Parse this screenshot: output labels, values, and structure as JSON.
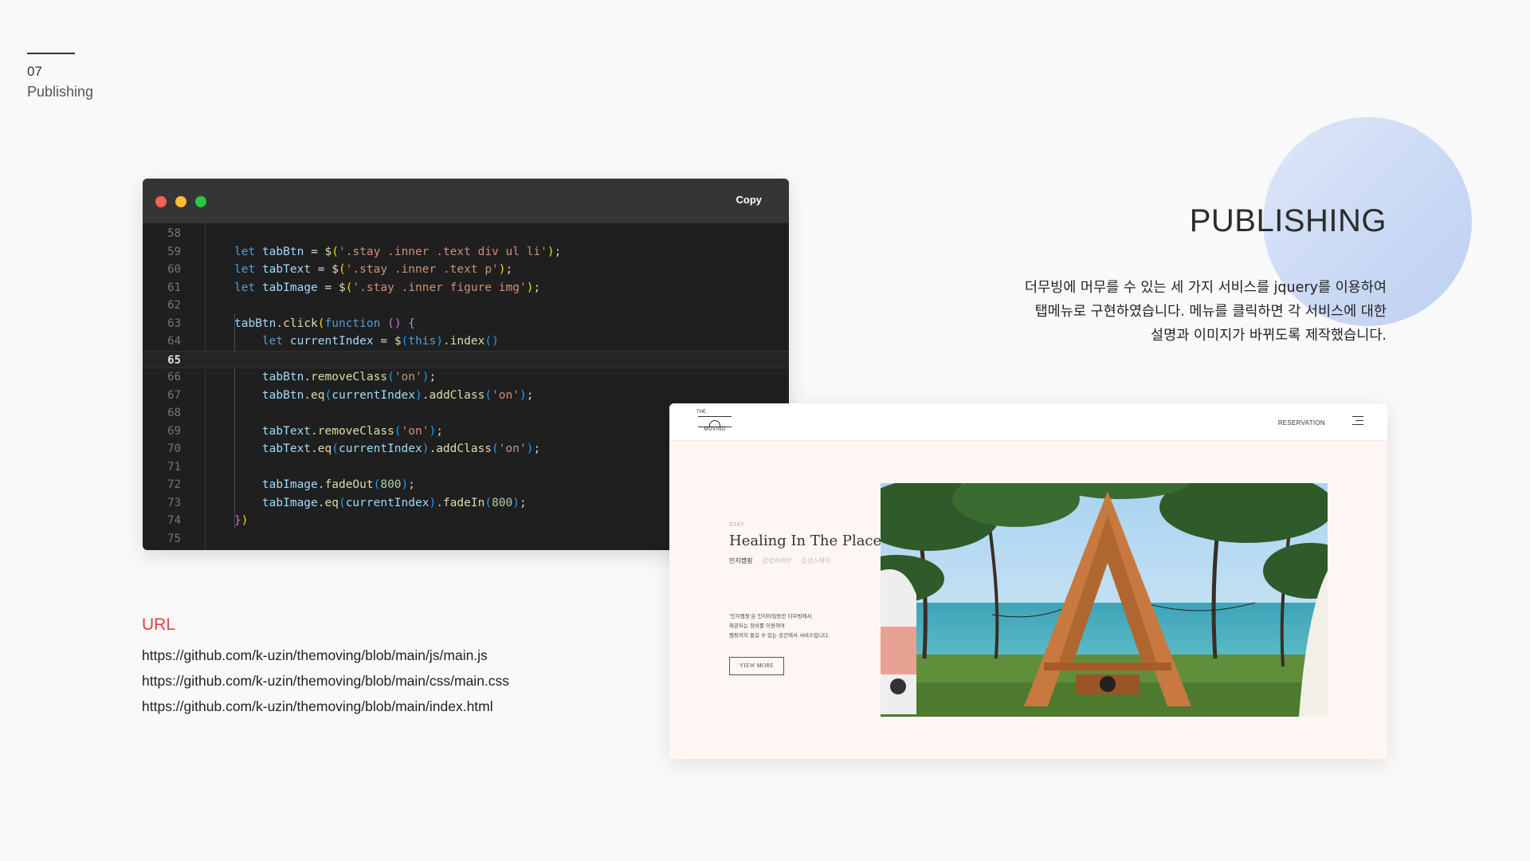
{
  "section": {
    "number": "07",
    "name": "Publishing"
  },
  "publishing": {
    "title": "PUBLISHING",
    "description_lines": [
      "더무빙에 머무를 수 있는 세 가지 서비스를 jquery를 이용하여",
      "탭메뉴로 구현하였습니다. 메뉴를 클릭하면 각 서비스에 대한",
      "설명과 이미지가 바뀌도록 제작했습니다."
    ]
  },
  "editor": {
    "copy_label": "Copy",
    "active_line": "65",
    "lines": [
      "58",
      "59",
      "60",
      "61",
      "62",
      "63",
      "64",
      "65",
      "66",
      "67",
      "68",
      "69",
      "70",
      "71",
      "72",
      "73",
      "74",
      "75"
    ]
  },
  "url": {
    "title": "URL",
    "links": [
      "https://github.com/k-uzin/themoving/blob/main/js/main.js",
      "https://github.com/k-uzin/themoving/blob/main/css/main.css",
      "https://github.com/k-uzin/themoving/blob/main/index.html"
    ]
  },
  "site": {
    "logo_top": "THE",
    "logo_bottom": "MOVING",
    "reservation": "RESERVATION",
    "stay_label": "STAY",
    "stay_title": "Healing In The Place",
    "tabs": [
      "인지캠핑",
      "감성카라반",
      "감성스테이"
    ],
    "desc_lines": [
      "'인지캠핑'은 인지타임동안 더무빙에서",
      "제공되는 장비를 이용하여",
      "캠핑까지 즐길 수 있는 공간에서 서비스입니다."
    ],
    "view_more": "VIEW MORE"
  },
  "colors": {
    "accent_red": "#e8403c",
    "circle_blue": "#c9d8f4",
    "editor_bg": "#1f1f1f",
    "site_bg": "#fdf6f3"
  }
}
